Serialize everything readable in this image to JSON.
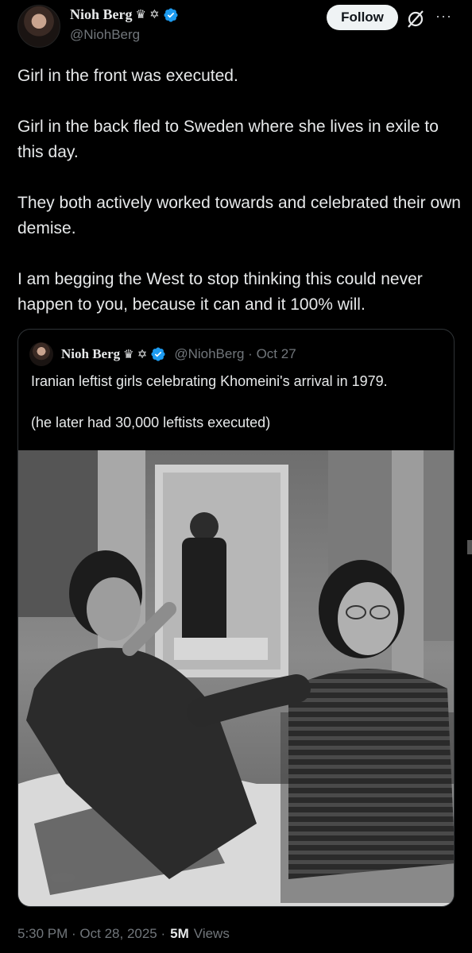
{
  "author": {
    "display_name": "Nioh Berg",
    "name_glyphs": "♛ ✡",
    "handle": "@NiohBerg"
  },
  "actions": {
    "follow_label": "Follow",
    "grok_icon": "grok-slash-icon",
    "more_icon": "more-dots-icon",
    "more_label": "···"
  },
  "post": {
    "paragraphs": [
      "Girl in the front was executed.",
      "Girl in the back fled to Sweden where she lives in exile to this day.",
      "They both actively worked towards and celebrated their own demise.",
      "I am begging the West to stop thinking this could never happen to you, because it can and it 100% will."
    ]
  },
  "quoted": {
    "display_name": "Nioh Berg",
    "name_glyphs": "♛ ✡",
    "handle_date": "@NiohBerg · Oct 27",
    "paragraphs": [
      "Iranian leftist girls celebrating Khomeini's arrival in 1979.",
      "(he later had 30,000 leftists executed)"
    ]
  },
  "footer": {
    "timestamp": "5:30 PM · Oct 28, 2025 ·",
    "views_count": "5M",
    "views_label": "Views"
  },
  "colors": {
    "background": "#000000",
    "text": "#e7e9ea",
    "secondary": "#71767b",
    "verified": "#1d9bf0",
    "border": "#2f3336"
  }
}
